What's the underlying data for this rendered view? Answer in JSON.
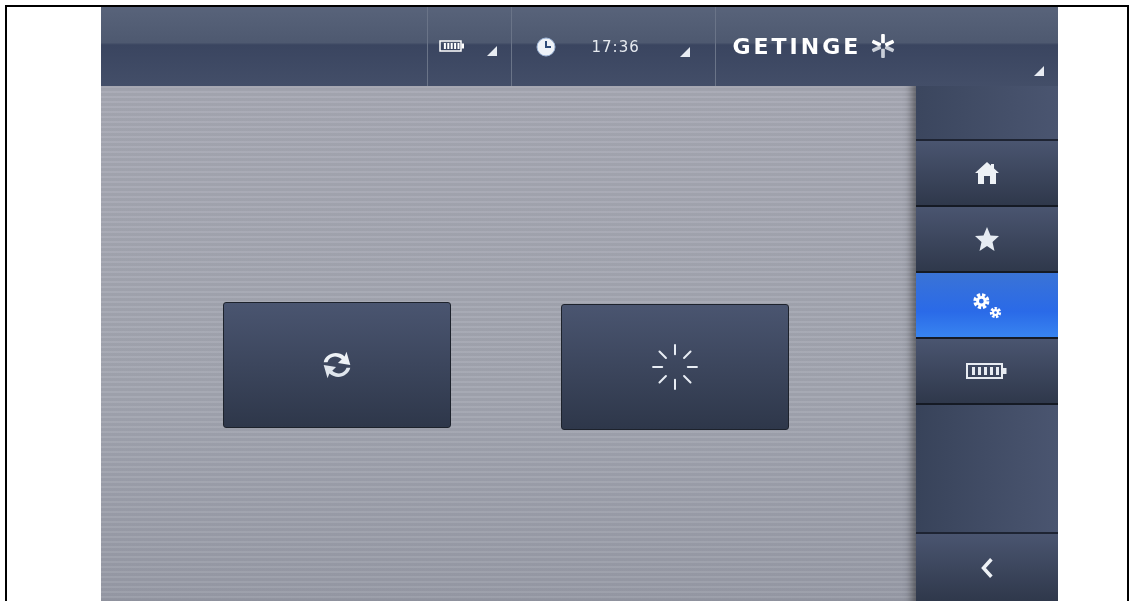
{
  "status_bar": {
    "battery": {
      "kind": "battery"
    },
    "time": "17:36",
    "logo": "GETINGE"
  },
  "main_buttons": [
    {
      "kind": "sync"
    },
    {
      "kind": "spinner"
    }
  ],
  "sidebar": {
    "items": [
      {
        "kind": "home",
        "selected": false
      },
      {
        "kind": "favorites",
        "selected": false
      },
      {
        "kind": "settings",
        "selected": true
      },
      {
        "kind": "battery",
        "selected": false
      }
    ],
    "back": {
      "kind": "back"
    }
  }
}
